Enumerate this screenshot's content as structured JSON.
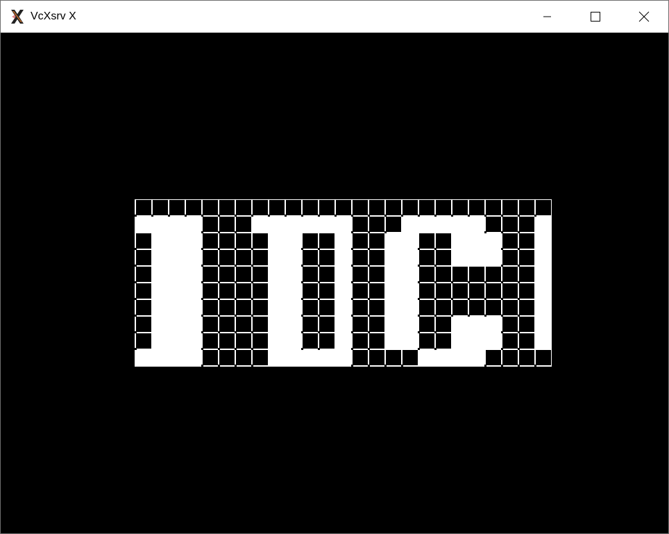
{
  "window": {
    "title": "VcXsrv X",
    "app_icon": "x-logo-icon",
    "controls": [
      {
        "name": "minimize",
        "icon": "minimize-icon"
      },
      {
        "name": "maximize",
        "icon": "maximize-icon"
      },
      {
        "name": "close",
        "icon": "close-icon"
      }
    ]
  },
  "canvas": {
    "background": "#000000",
    "board_background": "#ffffff",
    "cell_color": "#000000",
    "columns": 25,
    "rows": 10,
    "pattern": [
      "1111111111111111111111111",
      "0000111000000111000001110",
      "1000111100110110011000110",
      "1000111100110110011000110",
      "1000111100110110011111110",
      "1000111100110110011111110",
      "1000111100110110011111110",
      "1000111100110110011000110",
      "1000111100110110011000110",
      "0000111100000111100001111"
    ]
  }
}
